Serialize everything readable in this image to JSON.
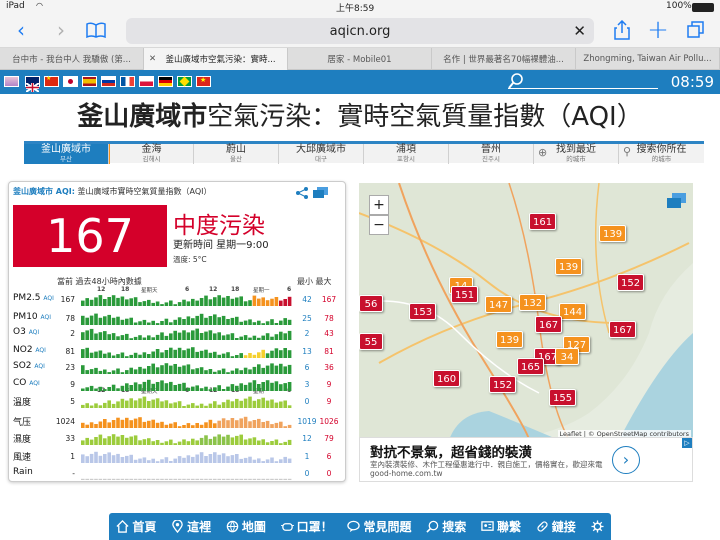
{
  "status": {
    "device": "iPad",
    "time": "上午8:59",
    "battery": "100%"
  },
  "browser": {
    "url": "aqicn.org",
    "tabs": [
      {
        "title": "台中市 - 我台中人 我驕傲 (第..."
      },
      {
        "title": "釜山廣域市空氣污染：實時...",
        "active": true
      },
      {
        "title": "居家 - Mobile01"
      },
      {
        "title": "名作 | 世界最著名70幅裸體油..."
      },
      {
        "title": "Zhongming, Taiwan Air Pollu..."
      }
    ]
  },
  "clock": "08:59",
  "title_bold": "釜山廣域市",
  "title_rest": "空氣污染：實時空氣質量指數（AQI）",
  "cities": [
    {
      "name": "釜山廣域市",
      "sub": "부산",
      "active": true
    },
    {
      "name": "金海",
      "sub": "김해시"
    },
    {
      "name": "蔚山",
      "sub": "울산"
    },
    {
      "name": "大邱廣域市",
      "sub": "대구"
    },
    {
      "name": "浦項",
      "sub": "포항시"
    },
    {
      "name": "晉州",
      "sub": "진주시"
    },
    {
      "name": "找到最近",
      "sub": "的城市"
    },
    {
      "name": "搜索你所在",
      "sub": "的城市"
    }
  ],
  "card": {
    "city": "釜山廣域市 AQI:",
    "subtitle": "釜山廣域市實時空氣質量指數（AQI）",
    "aqi": "167",
    "level": "中度污染",
    "update": "更新時间 星期一9:00",
    "temp": "溫度: 5°C",
    "hist_title": "當前 過去48小時內數據",
    "minmax_title": "最小 最大",
    "axis_labels": [
      "12",
      "18",
      "星期天",
      "6",
      "12",
      "18",
      "星期一",
      "6"
    ],
    "rows": [
      {
        "label": "PM2.5",
        "unit": "AQI",
        "value": "167",
        "min": "42",
        "max": "167",
        "color": "#2a9a3a"
      },
      {
        "label": "PM10",
        "unit": "AQI",
        "value": "78",
        "min": "25",
        "max": "78",
        "color": "#2a9a3a"
      },
      {
        "label": "O3",
        "unit": "AQI",
        "value": "2",
        "min": "2",
        "max": "43",
        "color": "#2a9a3a"
      },
      {
        "label": "NO2",
        "unit": "AQI",
        "value": "81",
        "min": "13",
        "max": "81",
        "color": "#2a9a3a"
      },
      {
        "label": "SO2",
        "unit": "AQI",
        "value": "23",
        "min": "6",
        "max": "36",
        "color": "#2a9a3a"
      },
      {
        "label": "CO",
        "unit": "AQI",
        "value": "9",
        "min": "3",
        "max": "9",
        "color": "#2a9a3a"
      },
      {
        "label": "溫度",
        "unit": "",
        "value": "5",
        "min": "0",
        "max": "9",
        "color": "#9ccc3c"
      },
      {
        "label": "气压",
        "unit": "",
        "value": "1024",
        "min": "1019",
        "max": "1026",
        "color": "#f5921e"
      },
      {
        "label": "濕度",
        "unit": "",
        "value": "33",
        "min": "12",
        "max": "79",
        "color": "#9ccc3c"
      },
      {
        "label": "風速",
        "unit": "",
        "value": "1",
        "min": "1",
        "max": "6",
        "color": "#b9c7e8"
      },
      {
        "label": "Rain",
        "unit": "",
        "value": "-",
        "min": "0",
        "max": "0",
        "color": "#cccccc"
      }
    ]
  },
  "map": {
    "attribution": "Leaflet | © OpenStreetMap contributors",
    "markers": [
      {
        "v": "161",
        "c": "r"
      },
      {
        "v": "139",
        "c": "o"
      },
      {
        "v": "139",
        "c": "o"
      },
      {
        "v": "56",
        "c": "r"
      },
      {
        "v": "14",
        "c": "o"
      },
      {
        "v": "151",
        "c": "r"
      },
      {
        "v": "147",
        "c": "o"
      },
      {
        "v": "132",
        "c": "o"
      },
      {
        "v": "152",
        "c": "r"
      },
      {
        "v": "153",
        "c": "r"
      },
      {
        "v": "144",
        "c": "o"
      },
      {
        "v": "167",
        "c": "r"
      },
      {
        "v": "167",
        "c": "r"
      },
      {
        "v": "55",
        "c": "r"
      },
      {
        "v": "139",
        "c": "o"
      },
      {
        "v": "127",
        "c": "o"
      },
      {
        "v": "167",
        "c": "r"
      },
      {
        "v": "34",
        "c": "o"
      },
      {
        "v": "165",
        "c": "r"
      },
      {
        "v": "160",
        "c": "r"
      },
      {
        "v": "152",
        "c": "r"
      },
      {
        "v": "155",
        "c": "r"
      }
    ]
  },
  "ad": {
    "title": "對抗不景氣，超省錢的裝潢",
    "desc": "室內裝潢裝修、木作工程優惠進行中．親自施工，價格實在，歡迎來電 good-home.com.tw"
  },
  "bottom_nav": [
    {
      "label": "首頁",
      "icon": "home-icon"
    },
    {
      "label": "這裡",
      "icon": "location-icon"
    },
    {
      "label": "地圖",
      "icon": "globe-icon"
    },
    {
      "label": "口罩！",
      "icon": "mask-icon"
    },
    {
      "label": "常見問題",
      "icon": "faq-icon"
    },
    {
      "label": "搜索",
      "icon": "search-icon"
    },
    {
      "label": "聯繫",
      "icon": "contact-icon"
    },
    {
      "label": "鏈接",
      "icon": "link-icon"
    },
    {
      "label": "",
      "icon": "gear-icon"
    }
  ]
}
